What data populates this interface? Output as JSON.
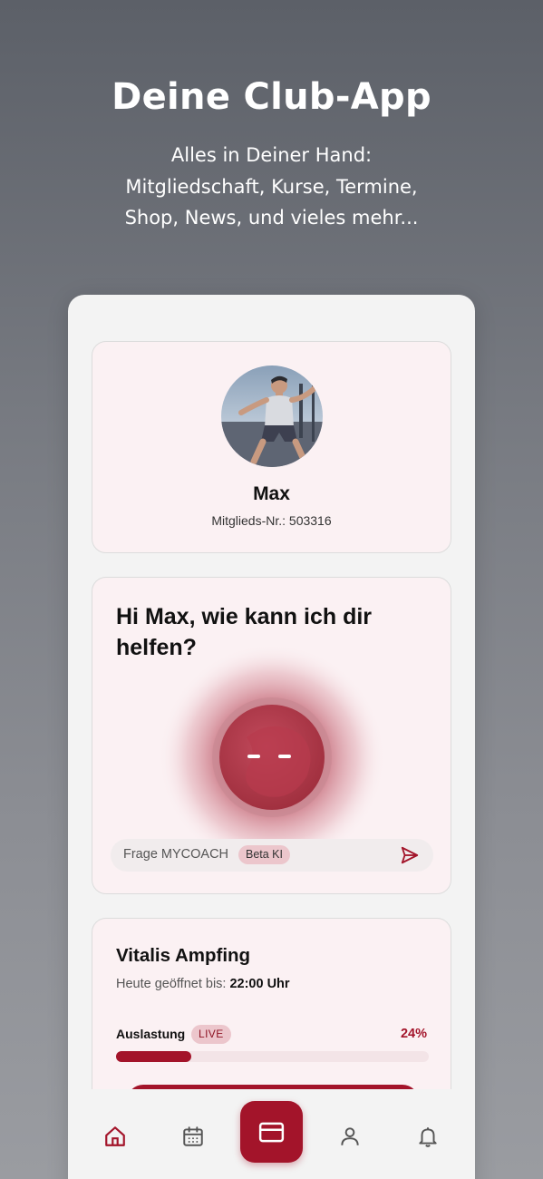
{
  "promo": {
    "headline": "Deine Club-App",
    "subline": [
      "Alles in Deiner Hand:",
      "Mitgliedschaft, Kurse, Termine,",
      "Shop, News, und vieles mehr..."
    ]
  },
  "profile": {
    "name": "Max",
    "member_number": "Mitglieds-Nr.: 503316"
  },
  "coach": {
    "greeting": "Hi Max, wie kann ich dir helfen?",
    "input_label": "Frage MYCOACH",
    "badge": "Beta KI"
  },
  "studio": {
    "name": "Vitalis Ampfing",
    "open_label": "Heute geöffnet bis:",
    "open_until": "22:00 Uhr",
    "load_label": "Auslastung",
    "live_badge": "LIVE",
    "load_percent_text": "24%",
    "load_fraction": 0.24
  },
  "tabbar": {
    "items": [
      {
        "icon": "home-icon",
        "active": true
      },
      {
        "icon": "calendar-icon",
        "active": false
      },
      {
        "icon": "membership-card-icon",
        "active": false
      },
      {
        "icon": "user-icon",
        "active": false
      },
      {
        "icon": "bell-icon",
        "active": false
      }
    ]
  },
  "colors": {
    "accent": "#a3142a",
    "card_background": "#fbf1f3",
    "badge_background": "#ecc6cc",
    "icon_inactive": "#555555"
  }
}
